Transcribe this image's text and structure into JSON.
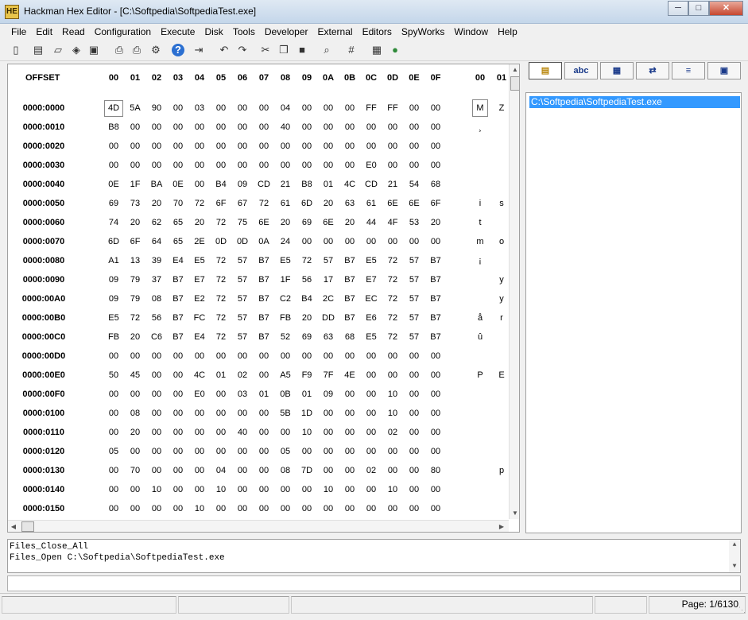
{
  "window": {
    "title": "Hackman Hex Editor - [C:\\Softpedia\\SoftpediaTest.exe]",
    "app_icon": "HE"
  },
  "menu": [
    "File",
    "Edit",
    "Read",
    "Configuration",
    "Execute",
    "Disk",
    "Tools",
    "Developer",
    "External",
    "Editors",
    "SpyWorks",
    "Window",
    "Help"
  ],
  "toolbar": [
    "new-file-icon",
    "open-folder-icon",
    "open-disk-icon",
    "open-memory-icon",
    "save-icon",
    "print-icon",
    "print-preview-icon",
    "settings-icon",
    "help-icon",
    "exit-icon",
    "undo-icon",
    "redo-icon",
    "cut-icon",
    "copy-icon",
    "paste-icon",
    "find-icon",
    "grid-icon",
    "calculator-icon",
    "globe-icon"
  ],
  "hex": {
    "offset_label": "OFFSET",
    "columns": [
      "00",
      "01",
      "02",
      "03",
      "04",
      "05",
      "06",
      "07",
      "08",
      "09",
      "0A",
      "0B",
      "0C",
      "0D",
      "0E",
      "0F"
    ],
    "ascii_columns": [
      "00",
      "01"
    ],
    "rows": [
      {
        "offset": "0000:0000",
        "bytes": [
          "4D",
          "5A",
          "90",
          "00",
          "03",
          "00",
          "00",
          "00",
          "04",
          "00",
          "00",
          "00",
          "FF",
          "FF",
          "00",
          "00"
        ],
        "ascii": [
          "M",
          "Z"
        ]
      },
      {
        "offset": "0000:0010",
        "bytes": [
          "B8",
          "00",
          "00",
          "00",
          "00",
          "00",
          "00",
          "00",
          "40",
          "00",
          "00",
          "00",
          "00",
          "00",
          "00",
          "00"
        ],
        "ascii": [
          "¸",
          ""
        ]
      },
      {
        "offset": "0000:0020",
        "bytes": [
          "00",
          "00",
          "00",
          "00",
          "00",
          "00",
          "00",
          "00",
          "00",
          "00",
          "00",
          "00",
          "00",
          "00",
          "00",
          "00"
        ],
        "ascii": [
          "",
          ""
        ]
      },
      {
        "offset": "0000:0030",
        "bytes": [
          "00",
          "00",
          "00",
          "00",
          "00",
          "00",
          "00",
          "00",
          "00",
          "00",
          "00",
          "00",
          "E0",
          "00",
          "00",
          "00"
        ],
        "ascii": [
          "",
          ""
        ]
      },
      {
        "offset": "0000:0040",
        "bytes": [
          "0E",
          "1F",
          "BA",
          "0E",
          "00",
          "B4",
          "09",
          "CD",
          "21",
          "B8",
          "01",
          "4C",
          "CD",
          "21",
          "54",
          "68"
        ],
        "ascii": [
          "",
          ""
        ]
      },
      {
        "offset": "0000:0050",
        "bytes": [
          "69",
          "73",
          "20",
          "70",
          "72",
          "6F",
          "67",
          "72",
          "61",
          "6D",
          "20",
          "63",
          "61",
          "6E",
          "6E",
          "6F"
        ],
        "ascii": [
          "i",
          "s"
        ]
      },
      {
        "offset": "0000:0060",
        "bytes": [
          "74",
          "20",
          "62",
          "65",
          "20",
          "72",
          "75",
          "6E",
          "20",
          "69",
          "6E",
          "20",
          "44",
          "4F",
          "53",
          "20"
        ],
        "ascii": [
          "t",
          ""
        ]
      },
      {
        "offset": "0000:0070",
        "bytes": [
          "6D",
          "6F",
          "64",
          "65",
          "2E",
          "0D",
          "0D",
          "0A",
          "24",
          "00",
          "00",
          "00",
          "00",
          "00",
          "00",
          "00"
        ],
        "ascii": [
          "m",
          "o"
        ]
      },
      {
        "offset": "0000:0080",
        "bytes": [
          "A1",
          "13",
          "39",
          "E4",
          "E5",
          "72",
          "57",
          "B7",
          "E5",
          "72",
          "57",
          "B7",
          "E5",
          "72",
          "57",
          "B7"
        ],
        "ascii": [
          "¡",
          ""
        ]
      },
      {
        "offset": "0000:0090",
        "bytes": [
          "09",
          "79",
          "37",
          "B7",
          "E7",
          "72",
          "57",
          "B7",
          "1F",
          "56",
          "17",
          "B7",
          "E7",
          "72",
          "57",
          "B7"
        ],
        "ascii": [
          "",
          "y"
        ]
      },
      {
        "offset": "0000:00A0",
        "bytes": [
          "09",
          "79",
          "08",
          "B7",
          "E2",
          "72",
          "57",
          "B7",
          "C2",
          "B4",
          "2C",
          "B7",
          "EC",
          "72",
          "57",
          "B7"
        ],
        "ascii": [
          "",
          "y"
        ]
      },
      {
        "offset": "0000:00B0",
        "bytes": [
          "E5",
          "72",
          "56",
          "B7",
          "FC",
          "72",
          "57",
          "B7",
          "FB",
          "20",
          "DD",
          "B7",
          "E6",
          "72",
          "57",
          "B7"
        ],
        "ascii": [
          "å",
          "r"
        ]
      },
      {
        "offset": "0000:00C0",
        "bytes": [
          "FB",
          "20",
          "C6",
          "B7",
          "E4",
          "72",
          "57",
          "B7",
          "52",
          "69",
          "63",
          "68",
          "E5",
          "72",
          "57",
          "B7"
        ],
        "ascii": [
          "û",
          ""
        ]
      },
      {
        "offset": "0000:00D0",
        "bytes": [
          "00",
          "00",
          "00",
          "00",
          "00",
          "00",
          "00",
          "00",
          "00",
          "00",
          "00",
          "00",
          "00",
          "00",
          "00",
          "00"
        ],
        "ascii": [
          "",
          ""
        ]
      },
      {
        "offset": "0000:00E0",
        "bytes": [
          "50",
          "45",
          "00",
          "00",
          "4C",
          "01",
          "02",
          "00",
          "A5",
          "F9",
          "7F",
          "4E",
          "00",
          "00",
          "00",
          "00"
        ],
        "ascii": [
          "P",
          "E"
        ]
      },
      {
        "offset": "0000:00F0",
        "bytes": [
          "00",
          "00",
          "00",
          "00",
          "E0",
          "00",
          "03",
          "01",
          "0B",
          "01",
          "09",
          "00",
          "00",
          "10",
          "00",
          "00"
        ],
        "ascii": [
          "",
          ""
        ]
      },
      {
        "offset": "0000:0100",
        "bytes": [
          "00",
          "08",
          "00",
          "00",
          "00",
          "00",
          "00",
          "00",
          "5B",
          "1D",
          "00",
          "00",
          "00",
          "10",
          "00",
          "00"
        ],
        "ascii": [
          "",
          ""
        ]
      },
      {
        "offset": "0000:0110",
        "bytes": [
          "00",
          "20",
          "00",
          "00",
          "00",
          "00",
          "40",
          "00",
          "00",
          "10",
          "00",
          "00",
          "00",
          "02",
          "00",
          "00"
        ],
        "ascii": [
          "",
          ""
        ]
      },
      {
        "offset": "0000:0120",
        "bytes": [
          "05",
          "00",
          "00",
          "00",
          "00",
          "00",
          "00",
          "00",
          "05",
          "00",
          "00",
          "00",
          "00",
          "00",
          "00",
          "00"
        ],
        "ascii": [
          "",
          ""
        ]
      },
      {
        "offset": "0000:0130",
        "bytes": [
          "00",
          "70",
          "00",
          "00",
          "00",
          "04",
          "00",
          "00",
          "08",
          "7D",
          "00",
          "00",
          "02",
          "00",
          "00",
          "80"
        ],
        "ascii": [
          "",
          "p"
        ]
      },
      {
        "offset": "0000:0140",
        "bytes": [
          "00",
          "00",
          "10",
          "00",
          "00",
          "10",
          "00",
          "00",
          "00",
          "00",
          "10",
          "00",
          "00",
          "10",
          "00",
          "00"
        ],
        "ascii": [
          "",
          ""
        ]
      },
      {
        "offset": "0000:0150",
        "bytes": [
          "00",
          "00",
          "00",
          "00",
          "10",
          "00",
          "00",
          "00",
          "00",
          "00",
          "00",
          "00",
          "00",
          "00",
          "00",
          "00"
        ],
        "ascii": [
          "",
          ""
        ]
      }
    ]
  },
  "side_tabs": [
    {
      "icon": "files-icon",
      "label": ""
    },
    {
      "icon": "text-abc-icon",
      "label": "abc"
    },
    {
      "icon": "table-icon",
      "label": ""
    },
    {
      "icon": "hex-convert-icon",
      "label": ""
    },
    {
      "icon": "layers-icon",
      "label": ""
    },
    {
      "icon": "disk-drive-icon",
      "label": ""
    }
  ],
  "files": [
    "C:\\Softpedia\\SoftpediaTest.exe"
  ],
  "log": [
    "Files_Close_All",
    "Files_Open C:\\Softpedia\\SoftpediaTest.exe"
  ],
  "status": {
    "page": "Page: 1/6130"
  }
}
